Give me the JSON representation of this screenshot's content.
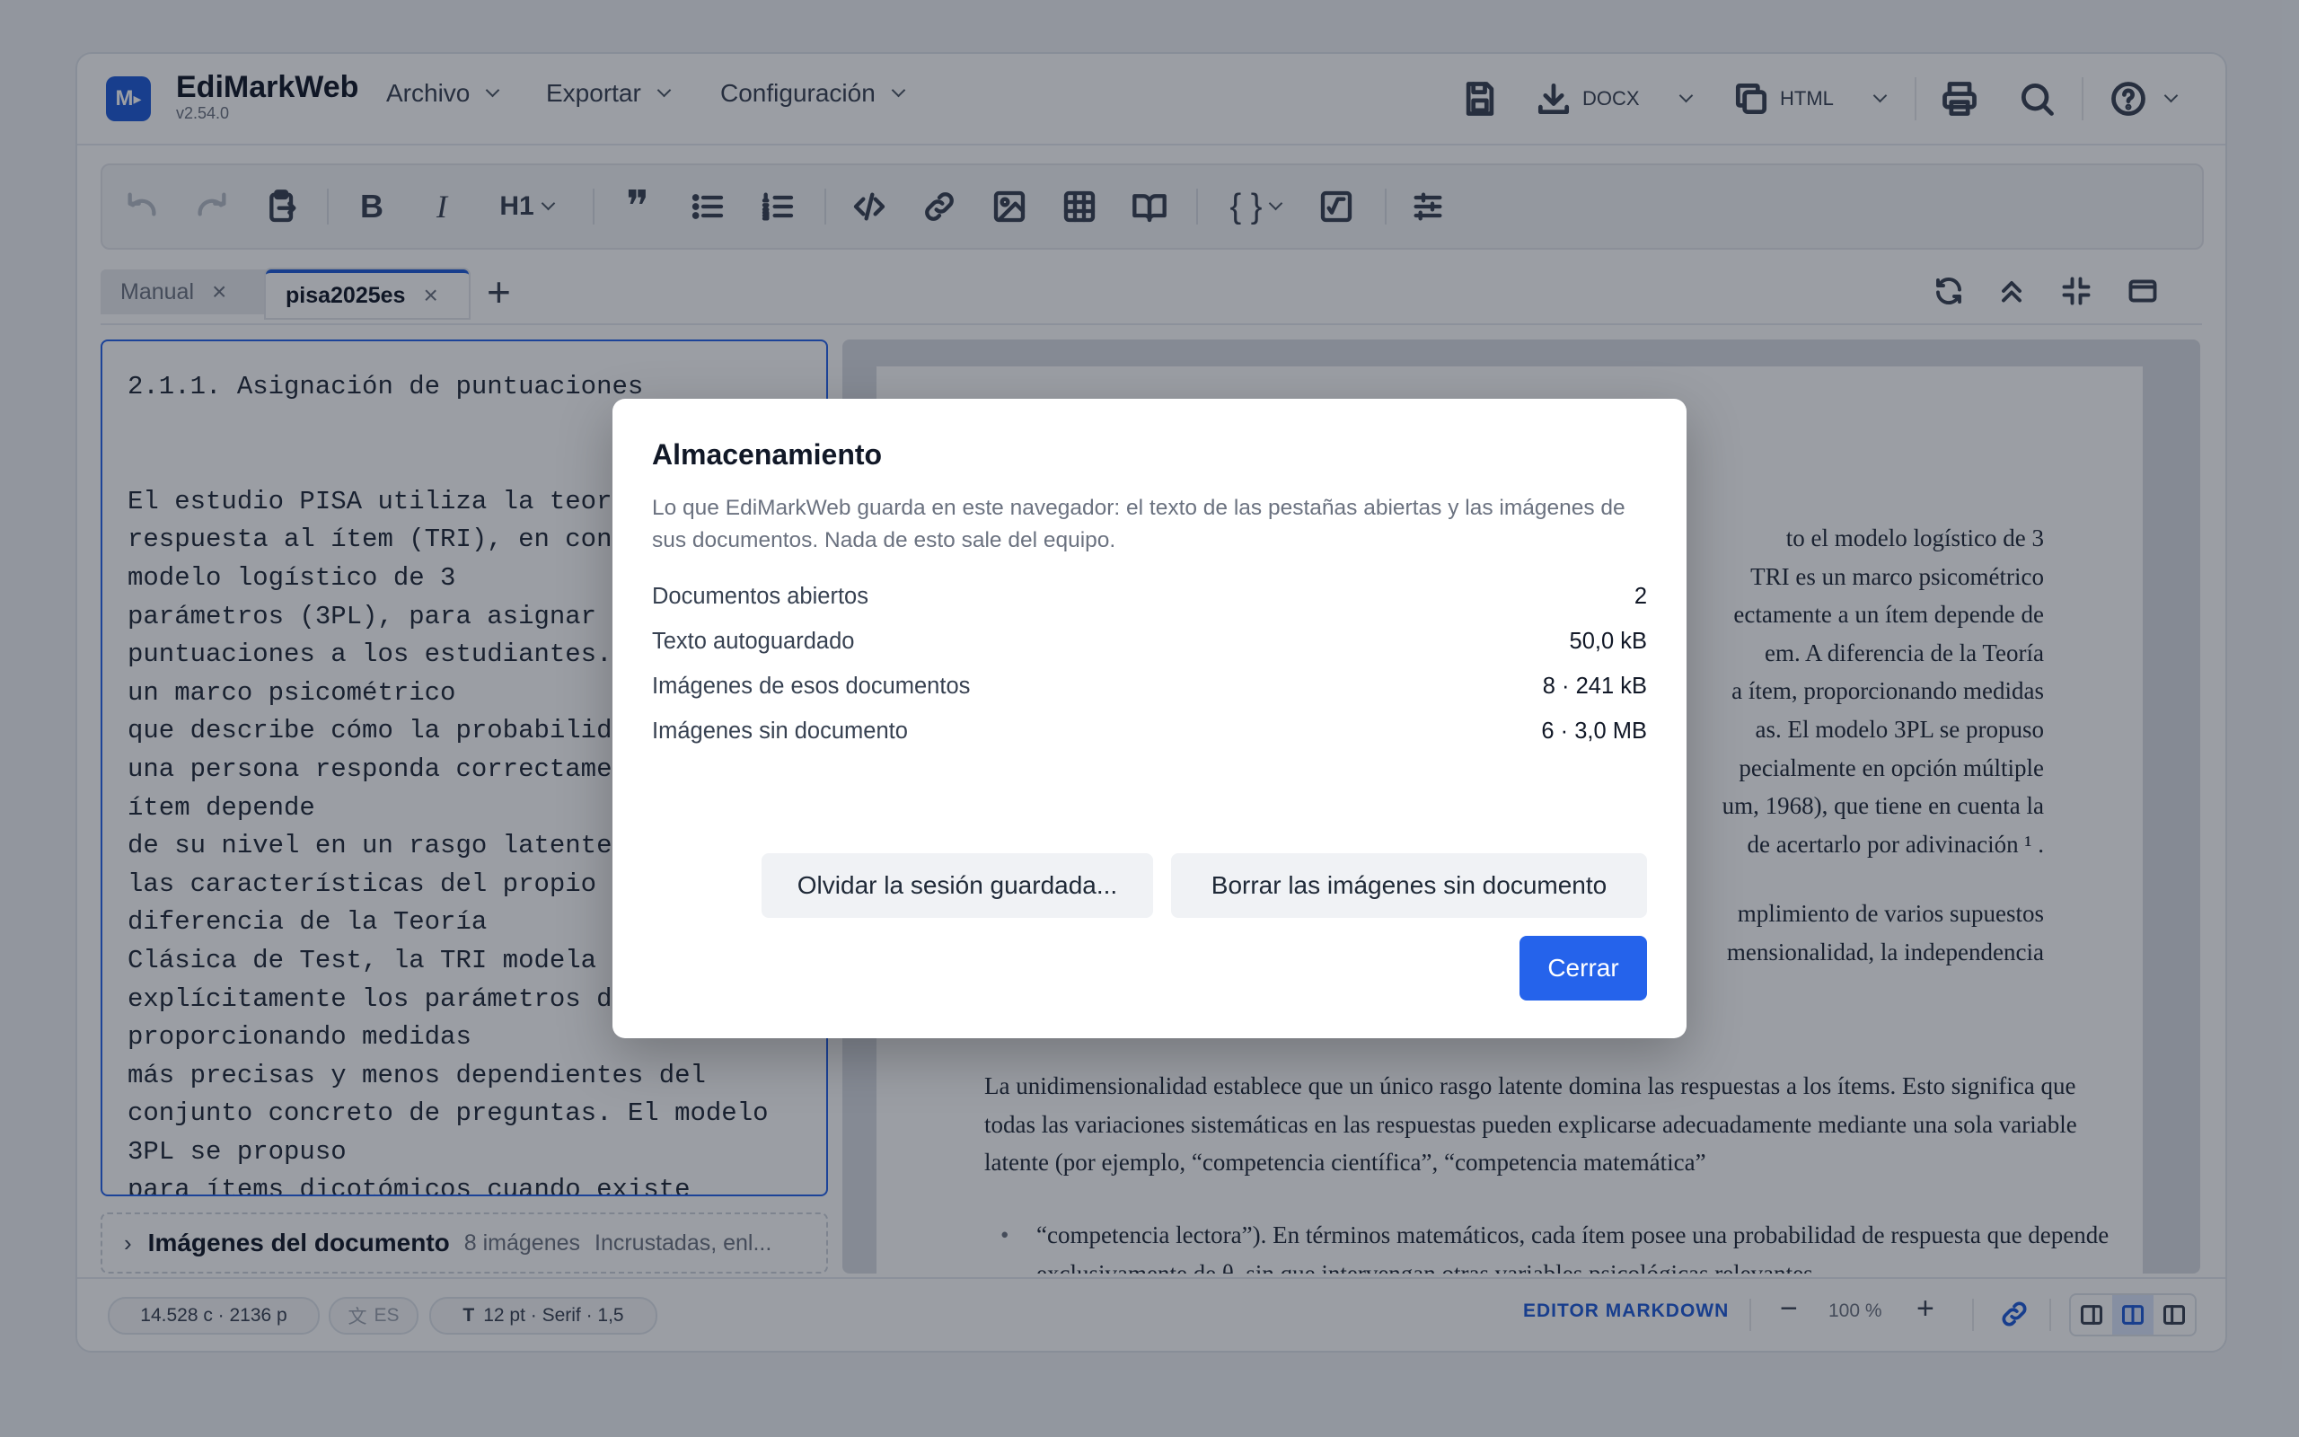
{
  "app": {
    "name": "EdiMarkWeb",
    "version": "v2.54.0",
    "logo_text": "M"
  },
  "menu": {
    "archivo": "Archivo",
    "exportar": "Exportar",
    "configuracion": "Configuración"
  },
  "header_actions": {
    "docx": "DOCX",
    "html": "HTML"
  },
  "toolbar": {
    "heading": "H1"
  },
  "tabs": [
    {
      "label": "Manual",
      "close": "×"
    },
    {
      "label": "pisa2025es",
      "close": "×"
    },
    {
      "add": "+"
    }
  ],
  "editor": {
    "text": "2.1.1. Asignación de puntuaciones\n\n\nEl estudio PISA utiliza la teoría de\nrespuesta al ítem (TRI), en concreto el\nmodelo logístico de 3\nparámetros (3PL), para asignar las\npuntuaciones a los estudiantes. La TRI es\nun marco psicométrico\nque describe cómo la probabilidad de que\nuna persona responda correctamente a un\nítem depende\nde su nivel en un rasgo latente y de\nlas características del propio ítem. A\ndiferencia de la Teoría\nClásica de Test, la TRI modela\nexplícitamente los parámetros de cada ítem,\nproporcionando medidas\nmás precisas y menos dependientes del\nconjunto concreto de preguntas. El modelo\n3PL se propuso\npara ítems dicotómicos cuando existe"
  },
  "images_panel": {
    "title": "Imágenes del documento",
    "count": "8 imágenes",
    "note": "Incrustadas, enl..."
  },
  "preview": {
    "p1": [
      "to el modelo logístico de 3",
      "TRI es un marco psicométrico",
      "ectamente a un ítem depende de",
      "em. A diferencia de la Teoría",
      "a ítem, proporcionando medidas",
      "as. El modelo 3PL se propuso",
      "pecialmente en opción múltiple",
      "um, 1968), que tiene en cuenta la",
      "de acertarlo por adivinación ¹ ."
    ],
    "p2": [
      "mplimiento de varios supuestos",
      "mensionalidad, la independencia"
    ],
    "p3": "La unidimensionalidad establece que un único rasgo latente domina las respuestas a los ítems. Esto significa que todas las variaciones sistemáticas en las respuestas pueden explicarse adecuadamente mediante una sola variable latente (por ejemplo, “competencia científica”, “competencia matemática”",
    "li": "“competencia lectora”). En términos matemáticos, cada ítem posee una probabilidad de respuesta que depende exclusivamente de θ, sin que intervengan otras variables psicológicas relevantes."
  },
  "status": {
    "counts": "14.528 c · 2136 p",
    "lang": "ES",
    "font": "12 pt · Serif · 1,5",
    "mode": "EDITOR MARKDOWN",
    "zoom": "100 %",
    "minus": "−",
    "plus": "+"
  },
  "modal": {
    "title": "Almacenamiento",
    "description": "Lo que EdiMarkWeb guarda en este navegador: el texto de las pestañas abiertas y las imágenes de sus documentos. Nada de esto sale del equipo.",
    "rows": [
      {
        "label": "Documentos abiertos",
        "value": "2"
      },
      {
        "label": "Texto autoguardado",
        "value": "50,0 kB"
      },
      {
        "label": "Imágenes de esos documentos",
        "value": "8 · 241 kB"
      },
      {
        "label": "Imágenes sin documento",
        "value": "6 · 3,0 MB"
      }
    ],
    "forget_button": "Olvidar la sesión guardada...",
    "delete_button": "Borrar las imágenes sin documento",
    "close_button": "Cerrar"
  },
  "colors": {
    "accent": "#2563eb",
    "brand": "#1e5bd8"
  }
}
